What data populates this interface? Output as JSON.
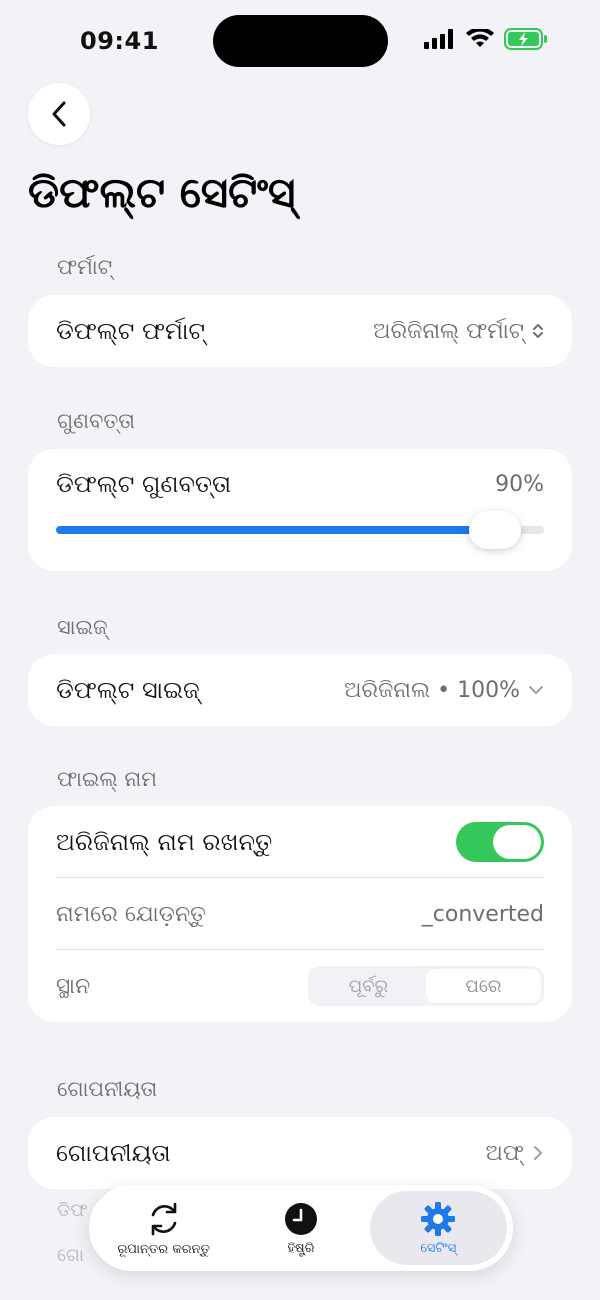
{
  "status": {
    "time": "09:41"
  },
  "page": {
    "title": "ଡିଫଲ୍ଟ ସେଟିଂସ୍"
  },
  "sections": {
    "format": {
      "header": "ଫର୍ମାଟ୍",
      "row_label": "ଡିଫଲ୍ଟ ଫର୍ମାଟ୍",
      "row_value": "ଅରିଜିନାଲ୍ ଫର୍ମାଟ୍"
    },
    "quality": {
      "header": "ଗୁଣବତ୍ତା",
      "row_label": "ଡିଫଲ୍ଟ ଗୁଣବତ୍ତା",
      "value_text": "90%",
      "value": 0.9
    },
    "size": {
      "header": "ସାଇଜ୍",
      "row_label": "ଡିଫଲ୍ଟ ସାଇଜ୍",
      "row_value": "ଅରିଜିନାଲ • 100%"
    },
    "filename": {
      "header": "ଫାଇଲ୍ ନାମ",
      "keep_label": "ଅରିଜିନାଲ୍ ନାମ ରଖନ୍ତୁ",
      "keep_on": true,
      "append_label": "ନାମରେ ଯୋଡ଼ନ୍ତୁ",
      "append_value": "_converted",
      "position_label": "ସ୍ଥାନ",
      "position_options": [
        "ପୂର୍ବରୁ",
        "ପରେ"
      ],
      "position_selected": "ପରେ"
    },
    "privacy": {
      "header": "ଗୋପନୀୟତା",
      "row_label": "ଗୋପନୀୟତା",
      "row_value": "ଅଫ୍"
    }
  },
  "peek": {
    "line1": "ଡିଫ",
    "line2": "ଗୋ"
  },
  "tabbar": {
    "tabs": [
      {
        "label": "ରୂପାନ୍ତର କରନ୍ତୁ",
        "icon": "convert-icon"
      },
      {
        "label": "ହିଷ୍ଟ୍ରି",
        "icon": "clock-icon"
      },
      {
        "label": "ସେଟିଂସ୍",
        "icon": "gear-icon"
      }
    ],
    "active": "ସେଟିଂସ୍"
  },
  "colors": {
    "accent": "#1e7ae8",
    "toggle_on": "#34c759",
    "background": "#f2f2f7",
    "battery": "#34c759"
  }
}
